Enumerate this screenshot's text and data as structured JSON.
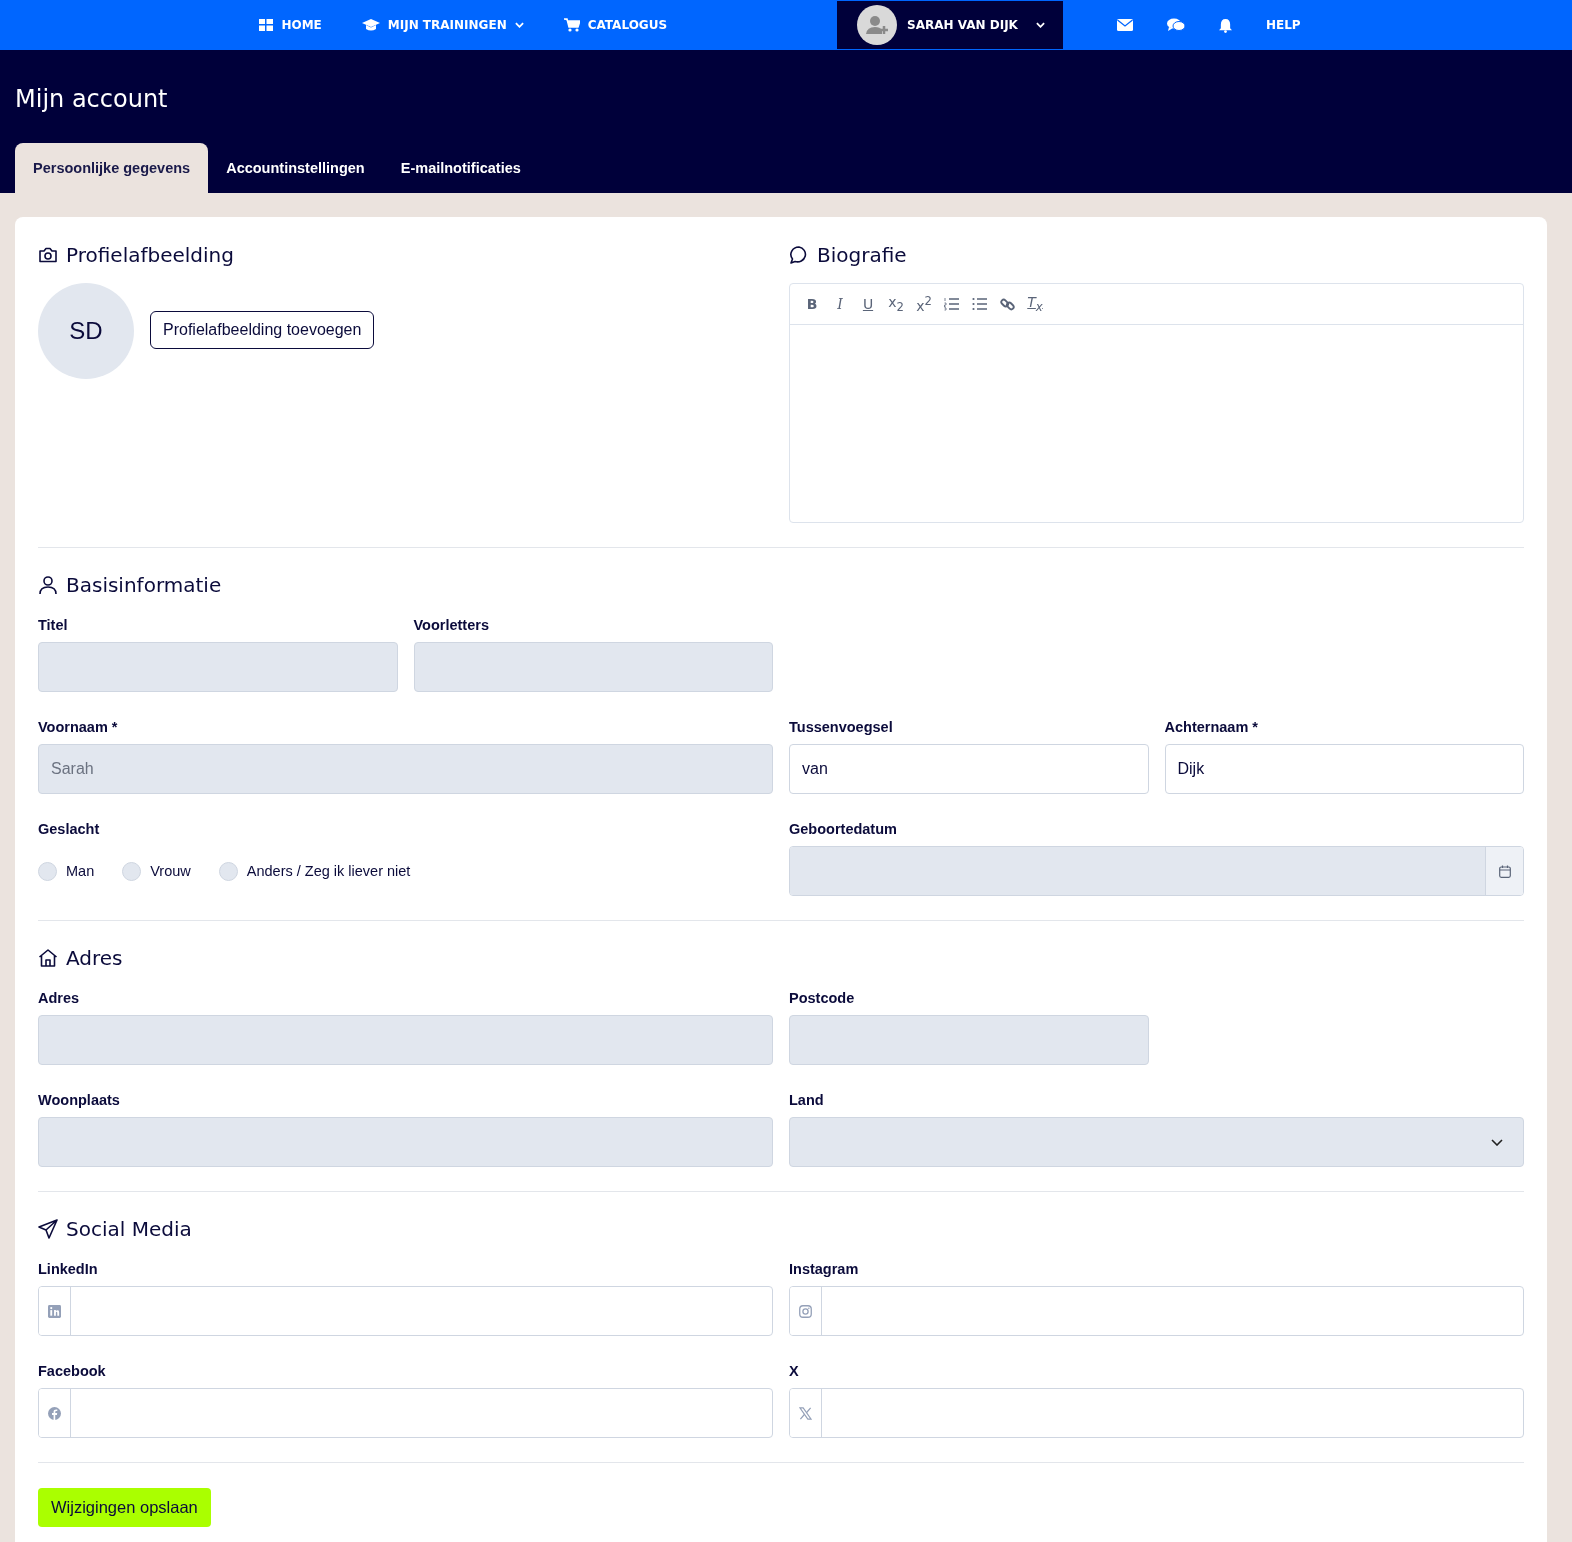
{
  "nav": {
    "items": [
      {
        "label": "HOME",
        "kind": "home",
        "dropdown": false
      },
      {
        "label": "MIJN TRAININGEN",
        "kind": "trainings",
        "dropdown": true
      },
      {
        "label": "CATALOGUS",
        "kind": "catalog",
        "dropdown": false
      }
    ],
    "user": {
      "name": "SARAH VAN DIJK",
      "dropdown": true
    },
    "help": "HELP"
  },
  "page_title": "Mijn account",
  "tabs": [
    {
      "label": "Persoonlijke gegevens",
      "selected": true
    },
    {
      "label": "Accountinstellingen",
      "selected": false
    },
    {
      "label": "E-mailnotificaties",
      "selected": false
    }
  ],
  "profile_picture": {
    "title": "Profielafbeelding",
    "initials": "SD",
    "button": "Profielafbeelding toevoegen"
  },
  "biography": {
    "title": "Biografie",
    "toolbar": [
      {
        "kind": "bold",
        "label": "B"
      },
      {
        "kind": "italic",
        "label": "I"
      },
      {
        "kind": "underline",
        "label": "U"
      },
      {
        "kind": "subscript",
        "label": "x$_{2}$"
      },
      {
        "kind": "superscript",
        "label": "x$^{2}$"
      },
      {
        "kind": "ordered-list"
      },
      {
        "kind": "bullet-list"
      },
      {
        "kind": "link"
      },
      {
        "kind": "clear-format",
        "label": "T$_{x}$"
      }
    ]
  },
  "sections": [
    {
      "title": "Basisinformatie",
      "kind": "basic",
      "fields": [
        {
          "kind": "text",
          "label": "Titel",
          "disabled": true
        },
        {
          "kind": "text",
          "label": "Voorletters",
          "disabled": true
        },
        {
          "kind": "text",
          "label": "Voornaam *",
          "value": "Sarah",
          "disabled": true
        },
        {
          "kind": "text",
          "label": "Tussenvoegsel",
          "value": "van",
          "disabled": false
        },
        {
          "kind": "text",
          "label": "Achternaam *",
          "value": "Dijk",
          "disabled": false
        },
        {
          "kind": "radio",
          "label": "Geslacht",
          "options": [
            {
              "label": "Man",
              "selected": false
            },
            {
              "label": "Vrouw",
              "selected": false
            },
            {
              "label": "Anders / Zeg ik liever niet",
              "selected": false
            }
          ]
        },
        {
          "kind": "date",
          "label": "Geboortedatum",
          "disabled": true
        }
      ]
    },
    {
      "title": "Adres",
      "kind": "address",
      "fields": [
        {
          "kind": "text",
          "label": "Adres",
          "disabled": true
        },
        {
          "kind": "text",
          "label": "Postcode",
          "disabled": true
        },
        {
          "kind": "text",
          "label": "Woonplaats",
          "disabled": true
        },
        {
          "kind": "select",
          "label": "Land",
          "disabled": true
        }
      ]
    },
    {
      "title": "Social Media",
      "kind": "social",
      "fields": [
        {
          "kind": "linkedin",
          "label": "LinkedIn",
          "disabled": false
        },
        {
          "kind": "instagram",
          "label": "Instagram",
          "disabled": false
        },
        {
          "kind": "facebook",
          "label": "Facebook",
          "disabled": false
        },
        {
          "kind": "x",
          "label": "X",
          "disabled": false
        }
      ]
    }
  ],
  "save_button": "Wijzigingen opslaan"
}
